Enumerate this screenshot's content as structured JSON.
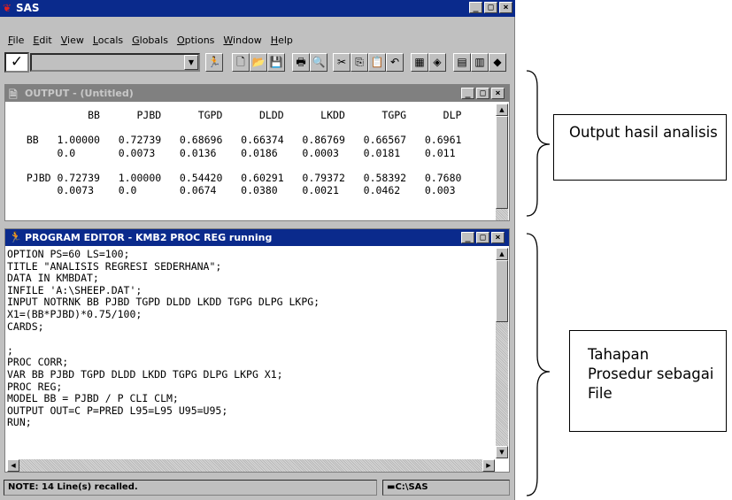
{
  "app": {
    "title": "SAS"
  },
  "menu": [
    "File",
    "Edit",
    "View",
    "Locals",
    "Globals",
    "Options",
    "Window",
    "Help"
  ],
  "toolbar": {
    "command_check": "✓",
    "command_value": "",
    "buttons": [
      "run-icon",
      "new-icon",
      "open-icon",
      "save-icon",
      "print-icon",
      "print-preview-icon",
      "cut-icon",
      "copy-icon",
      "paste-icon",
      "undo-icon",
      "sas-explorer-icon",
      "libraries-icon",
      "log-icon",
      "output-icon",
      "help-icon"
    ]
  },
  "output_window": {
    "title": "OUTPUT - (Untitled)",
    "title_color": "#808080",
    "text": "            BB      PJBD      TGPD      DLDD      LKDD      TGPG      DLP\n\n  BB   1.00000   0.72739   0.68696   0.66374   0.86769   0.66567   0.6961\n       0.0       0.0073    0.0136    0.0186    0.0003    0.0181    0.011\n\n  PJBD 0.72739   1.00000   0.54420   0.60291   0.79372   0.58392   0.7680\n       0.0073    0.0       0.0674    0.0380    0.0021    0.0462    0.003"
  },
  "editor_window": {
    "title": "PROGRAM EDITOR - KMB2 PROC REG running",
    "title_color": "#0a2a8c",
    "lines": [
      "OPTION PS=60 LS=100;",
      "TITLE \"ANALISIS REGRESI SEDERHANA\";",
      "DATA IN KMBDAT;",
      "INFILE 'A:\\SHEEP.DAT';",
      "INPUT NOTRNK BB PJBD TGPD DLDD LKDD TGPG DLPG LKPG;",
      "X1=(BB*PJBD)*0.75/100;",
      "CARDS;",
      "",
      ";",
      "PROC CORR;",
      "VAR BB PJBD TGPD DLDD LKDD TGPG DLPG LKPG X1;",
      "PROC REG;",
      "MODEL BB = PJBD / P CLI CLM;",
      "OUTPUT OUT=C P=PRED L95=L95 U95=U95;",
      "RUN;"
    ]
  },
  "status": {
    "message": "NOTE: 14 Line(s) recalled.",
    "path": "C:\\SAS"
  },
  "annotations": [
    {
      "text": "Output hasil analisis"
    },
    {
      "text": "Tahapan Prosedur sebagai File"
    }
  ]
}
